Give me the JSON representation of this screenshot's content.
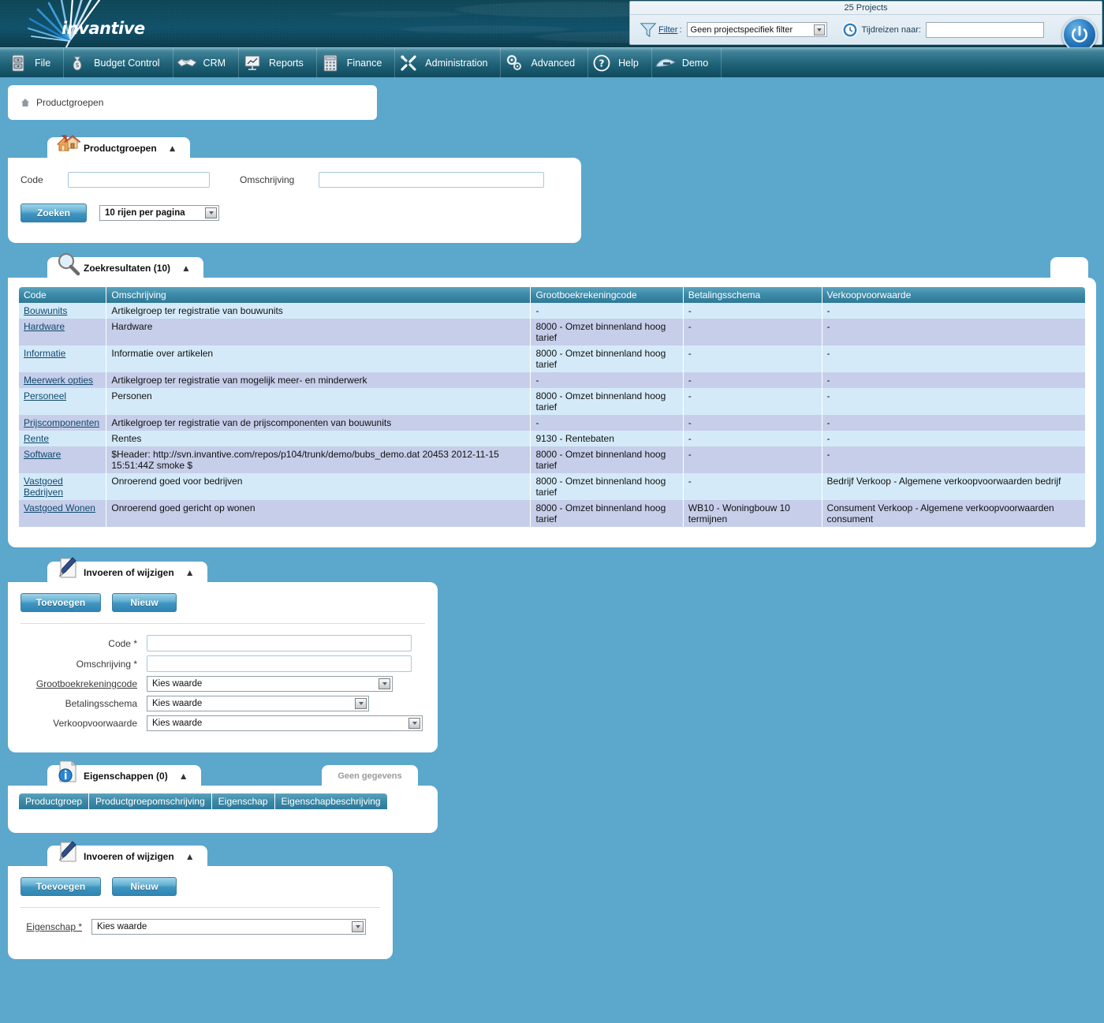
{
  "header": {
    "logo_text": "invantive",
    "projects_count": "25 Projects",
    "filter_label": "Filter",
    "filter_colon": ":",
    "filter_value": "Geen projectspecifiek filter",
    "timetravel_label": "Tijdreizen naar:",
    "timetravel_value": "",
    "icons": {
      "funnel": "funnel-icon",
      "clock": "clock-icon",
      "power": "power-icon"
    }
  },
  "menu": {
    "items": [
      {
        "label": "File",
        "icon": "file-cabinet-icon"
      },
      {
        "label": "Budget Control",
        "icon": "money-bag-icon"
      },
      {
        "label": "CRM",
        "icon": "handshake-icon"
      },
      {
        "label": "Reports",
        "icon": "presentation-chart-icon"
      },
      {
        "label": "Finance",
        "icon": "calculator-icon"
      },
      {
        "label": "Administration",
        "icon": "tools-icon"
      },
      {
        "label": "Advanced",
        "icon": "gears-icon"
      },
      {
        "label": "Help",
        "icon": "question-circle-icon"
      },
      {
        "label": "Demo",
        "icon": "wave-icon"
      }
    ]
  },
  "breadcrumb": {
    "home_icon": "home-icon",
    "text": "Productgroepen"
  },
  "search_panel": {
    "tab_title": "Productgroepen",
    "tab_icon": "house-icon",
    "collapse_icon": "chevron-up-icon",
    "code_label": "Code",
    "code_value": "",
    "omschrijving_label": "Omschrijving",
    "omschrijving_value": "",
    "search_button": "Zoeken",
    "rows_per_page": "10 rijen per pagina"
  },
  "results_panel": {
    "tab_title": "Zoekresultaten (10)",
    "tab_icon": "magnifier-icon",
    "collapse_icon": "chevron-up-icon",
    "columns": [
      "Code",
      "Omschrijving",
      "Grootboekrekeningcode",
      "Betalingsschema",
      "Verkoopvoorwaarde"
    ],
    "rows": [
      {
        "code": "Bouwunits",
        "omschrijving": "Artikelgroep ter registratie van bouwunits",
        "grootboekrekeningcode": "-",
        "betalingsschema": "-",
        "verkoopvoorwaarde": "-"
      },
      {
        "code": "Hardware",
        "omschrijving": "Hardware",
        "grootboekrekeningcode": "8000 - Omzet binnenland hoog tarief",
        "betalingsschema": "-",
        "verkoopvoorwaarde": "-"
      },
      {
        "code": "Informatie",
        "omschrijving": "Informatie over artikelen",
        "grootboekrekeningcode": "8000 - Omzet binnenland hoog tarief",
        "betalingsschema": "-",
        "verkoopvoorwaarde": "-"
      },
      {
        "code": "Meerwerk opties",
        "omschrijving": "Artikelgroep ter registratie van mogelijk meer- en minderwerk",
        "grootboekrekeningcode": "-",
        "betalingsschema": "-",
        "verkoopvoorwaarde": "-"
      },
      {
        "code": "Personeel",
        "omschrijving": "Personen",
        "grootboekrekeningcode": "8000 - Omzet binnenland hoog tarief",
        "betalingsschema": "-",
        "verkoopvoorwaarde": "-"
      },
      {
        "code": "Prijscomponenten",
        "omschrijving": "Artikelgroep ter registratie van de prijscomponenten van bouwunits",
        "grootboekrekeningcode": "-",
        "betalingsschema": "-",
        "verkoopvoorwaarde": "-"
      },
      {
        "code": "Rente",
        "omschrijving": "Rentes",
        "grootboekrekeningcode": "9130 - Rentebaten",
        "betalingsschema": "-",
        "verkoopvoorwaarde": "-"
      },
      {
        "code": "Software",
        "omschrijving": "$Header: http://svn.invantive.com/repos/p104/trunk/demo/bubs_demo.dat 20453 2012-11-15 15:51:44Z smoke $",
        "grootboekrekeningcode": "8000 - Omzet binnenland hoog tarief",
        "betalingsschema": "-",
        "verkoopvoorwaarde": "-"
      },
      {
        "code": "Vastgoed Bedrijven",
        "omschrijving": "Onroerend goed voor bedrijven",
        "grootboekrekeningcode": "8000 - Omzet binnenland hoog tarief",
        "betalingsschema": "-",
        "verkoopvoorwaarde": "Bedrijf Verkoop - Algemene verkoopvoorwaarden bedrijf"
      },
      {
        "code": "Vastgoed Wonen",
        "omschrijving": "Onroerend goed gericht op wonen",
        "grootboekrekeningcode": "8000 - Omzet binnenland hoog tarief",
        "betalingsschema": "WB10 - Woningbouw 10 termijnen",
        "verkoopvoorwaarde": "Consument Verkoop - Algemene verkoopvoorwaarden consument"
      }
    ]
  },
  "edit_panel": {
    "tab_title": "Invoeren of wijzigen",
    "tab_icon": "pencil-document-icon",
    "collapse_icon": "chevron-up-icon",
    "add_button": "Toevoegen",
    "new_button": "Nieuw",
    "fields": {
      "code_label": "Code *",
      "code_value": "",
      "omschrijving_label": "Omschrijving *",
      "omschrijving_value": "",
      "grootboek_label": "Grootboekrekeningcode",
      "grootboek_value": "Kies waarde",
      "betalingsschema_label": "Betalingsschema",
      "betalingsschema_value": "Kies waarde",
      "verkoopvoorwaarde_label": "Verkoopvoorwaarde",
      "verkoopvoorwaarde_value": "Kies waarde"
    }
  },
  "properties_panel": {
    "tab_title": "Eigenschappen (0)",
    "tab_icon": "info-document-icon",
    "collapse_icon": "chevron-up-icon",
    "no_data": "Geen gegevens",
    "columns": [
      "Productgroep",
      "Productgroepomschrijving",
      "Eigenschap",
      "Eigenschapbeschrijving"
    ]
  },
  "edit_panel2": {
    "tab_title": "Invoeren of wijzigen",
    "tab_icon": "pencil-document-icon",
    "collapse_icon": "chevron-up-icon",
    "add_button": "Toevoegen",
    "new_button": "Nieuw",
    "eigenschap_label": "Eigenschap *",
    "eigenschap_value": "Kies waarde"
  },
  "colors": {
    "page_background": "#5ca7cc",
    "banner_dark": "#0d4352",
    "menubar_teal": "#1f6277",
    "table_header": "#3e8ba9",
    "row_odd": "#d4eaf9",
    "row_even": "#c6cee9",
    "link": "#10496e",
    "button_blue": "#3f95bf"
  }
}
